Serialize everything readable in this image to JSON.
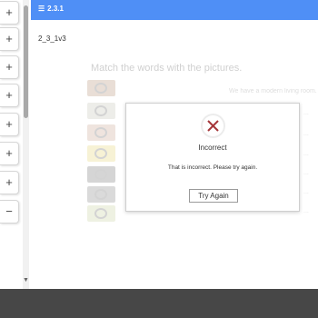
{
  "toolbox": {
    "buttons": [
      "+",
      "+",
      "+",
      "+",
      "+",
      "+",
      "+",
      "−"
    ]
  },
  "header": {
    "title": "2.3.1",
    "menu_icon": "menu-icon"
  },
  "page": {
    "activity_id": "2_3_1v3",
    "instruction": "Match the words with the pictures.",
    "visible_words": [
      "We have a modern living room.",
      "...",
      "...",
      "...",
      "...",
      "...",
      "..."
    ],
    "pictures": [
      {
        "name": "picture-1",
        "color": "#b48a70"
      },
      {
        "name": "picture-2",
        "color": "#bfbfb2"
      },
      {
        "name": "picture-3",
        "color": "#c9a08a"
      },
      {
        "name": "picture-4",
        "color": "#e3d26a"
      },
      {
        "name": "picture-5",
        "color": "#6d6d6d"
      },
      {
        "name": "picture-6",
        "color": "#7d7d7d"
      },
      {
        "name": "picture-7",
        "color": "#c6cf9a"
      }
    ]
  },
  "modal": {
    "icon": "x-cross-icon",
    "icon_color": "#a6373a",
    "title": "Incorrect",
    "message": "That is incorrect. Please try again.",
    "button_label": "Try Again"
  }
}
